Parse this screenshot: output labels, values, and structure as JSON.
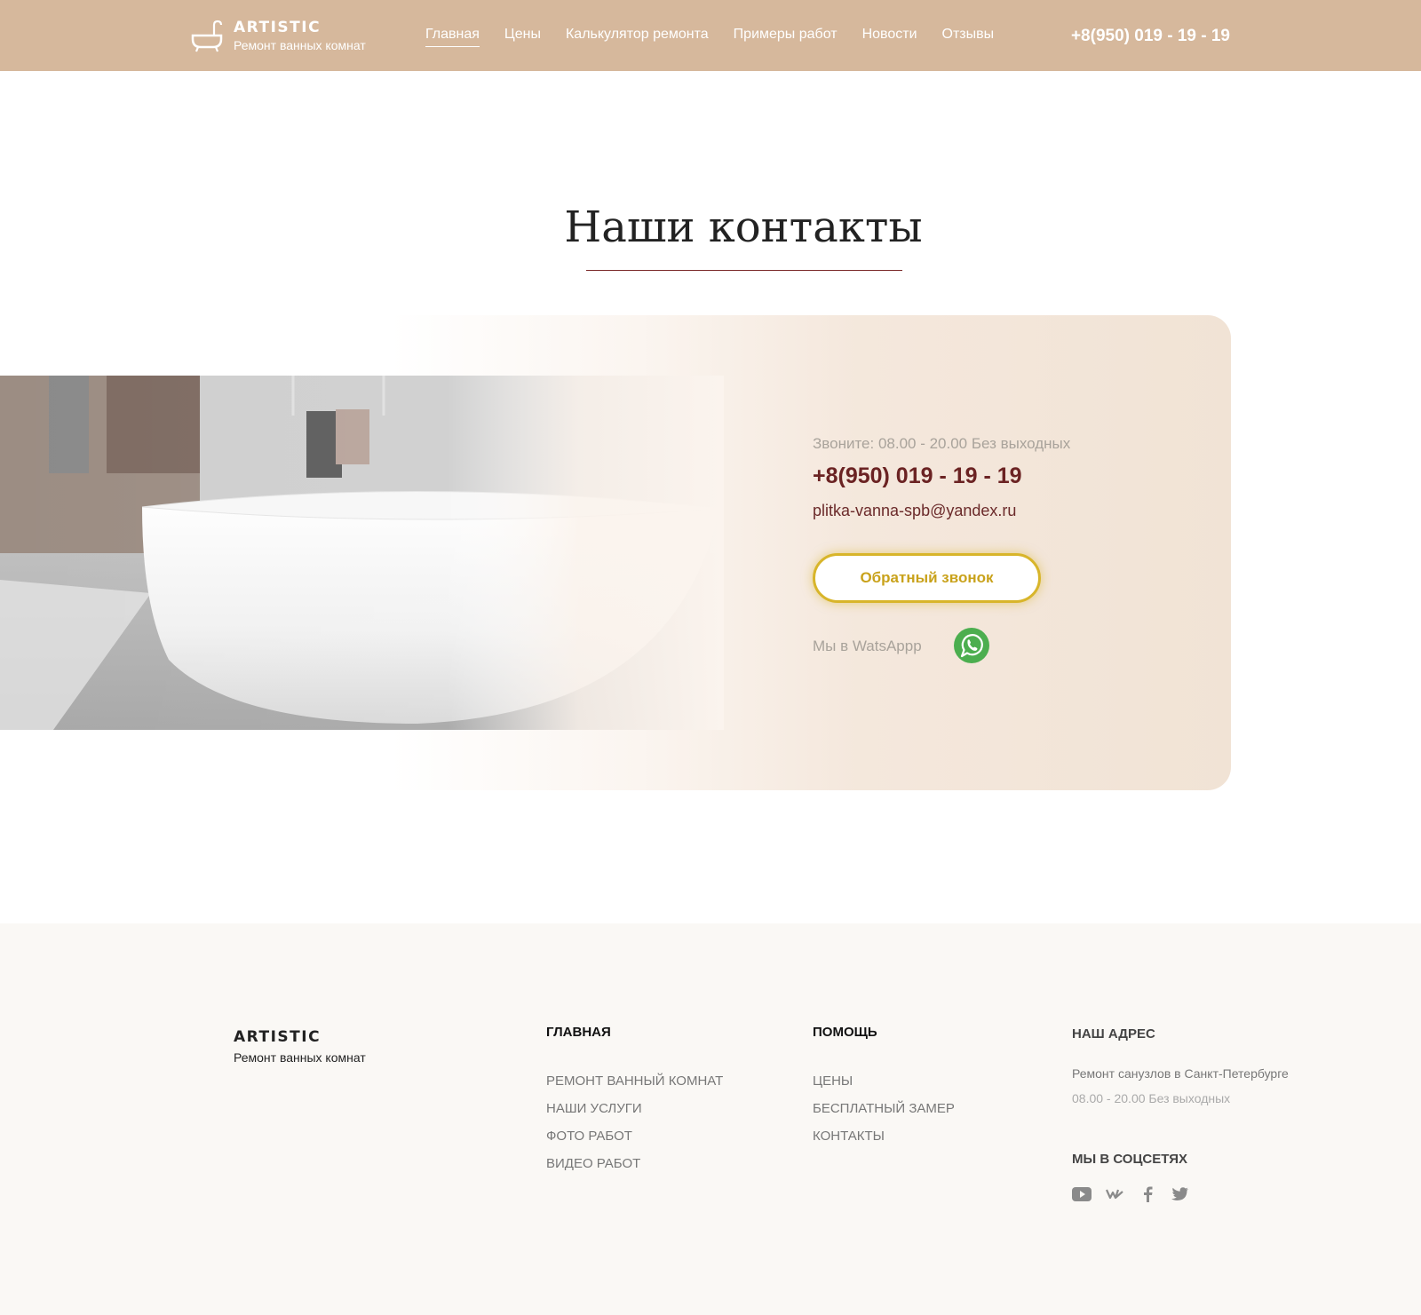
{
  "header": {
    "brand": "ARTISTIC",
    "tagline": "Ремонт ванных комнат",
    "nav": [
      {
        "label": "Главная"
      },
      {
        "label": "Цены"
      },
      {
        "label": "Калькулятор ремонта"
      },
      {
        "label": "Примеры работ"
      },
      {
        "label": "Новости"
      },
      {
        "label": "Отзывы"
      }
    ],
    "phone": "+8(950) 019 - 19 - 19"
  },
  "main": {
    "title": "Наши контакты",
    "hours": "Звоните: 08.00 - 20.00 Без выходных",
    "phone": "+8(950) 019 - 19 - 19",
    "email": "plitka-vanna-spb@yandex.ru",
    "callback_label": "Обратный звонок",
    "whatsapp_label": "Мы в WatsAppp"
  },
  "footer": {
    "brand": "ARTISTIC",
    "tagline": "Ремонт ванных комнат",
    "col_main": {
      "title": "ГЛАВНАЯ",
      "items": [
        "РЕМОНТ ВАННЫЙ КОМНАТ",
        "НАШИ УСЛУГИ",
        "ФОТО РАБОТ",
        "ВИДЕО РАБОТ"
      ]
    },
    "col_help": {
      "title": "ПОМОЩЬ",
      "items": [
        "ЦЕНЫ",
        "БЕСПЛАТНЫЙ ЗАМЕР",
        "КОНТАКТЫ"
      ]
    },
    "address": {
      "title": "НАШ АДРЕС",
      "line1": "Ремонт санузлов в Санкт-Петербурге",
      "line2": "08.00 - 20.00 Без выходных"
    },
    "social_title": "МЫ В СОЦСЕТЯХ",
    "social_icons": [
      "youtube-icon",
      "vk-icon",
      "facebook-icon",
      "twitter-icon"
    ]
  },
  "colors": {
    "header_bg": "#d6b89c",
    "accent_dark": "#6b2323",
    "button_gold": "#d8b52a",
    "whatsapp_green": "#4cae4f"
  }
}
